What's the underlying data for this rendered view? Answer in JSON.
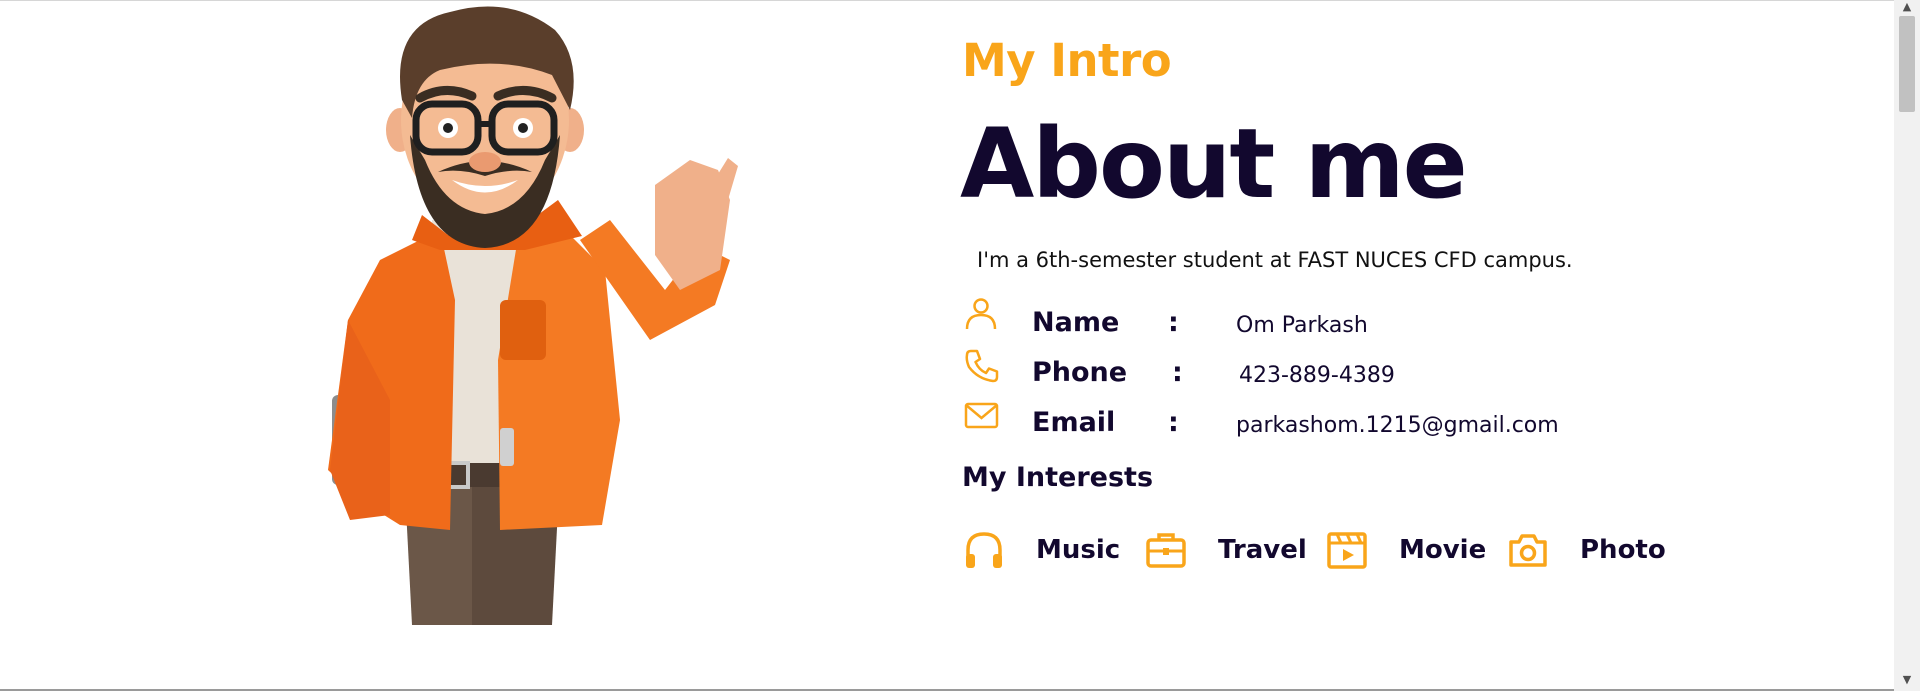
{
  "about": {
    "intro_label": "My Intro",
    "title": "About me",
    "description": "I'm a 6th-semester student at FAST NUCES CFD campus."
  },
  "details": [
    {
      "icon": "user-icon",
      "label": "Name",
      "colon": ":",
      "value": "Om Parkash"
    },
    {
      "icon": "phone-icon",
      "label": "Phone",
      "colon": ":",
      "value": "423-889-4389"
    },
    {
      "icon": "envelope-icon",
      "label": "Email",
      "colon": ":",
      "value": "parkashom.1215@gmail.com"
    }
  ],
  "interests": {
    "title": "My Interests",
    "items": [
      {
        "icon": "headphones-icon",
        "label": "Music"
      },
      {
        "icon": "briefcase-icon",
        "label": "Travel"
      },
      {
        "icon": "film-icon",
        "label": "Movie"
      },
      {
        "icon": "camera-icon",
        "label": "Photo"
      }
    ]
  },
  "colors": {
    "accent": "#f9a51a",
    "heading": "#12082e",
    "background": "#ffffff"
  }
}
